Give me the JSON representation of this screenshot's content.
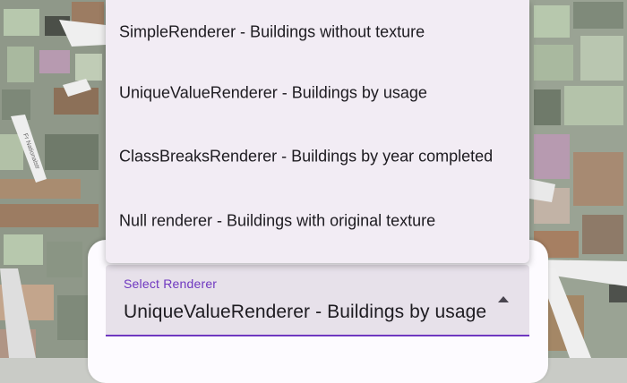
{
  "menu": {
    "items": [
      {
        "label": "SimpleRenderer - Buildings without texture"
      },
      {
        "label": "UniqueValueRenderer - Buildings by usage"
      },
      {
        "label": "ClassBreaksRenderer - Buildings by year completed"
      },
      {
        "label": "Null renderer - Buildings with original texture"
      }
    ]
  },
  "select": {
    "label": "Select Renderer",
    "value": "UniqueValueRenderer - Buildings by usage"
  },
  "map": {
    "street_label": "Fr Nationalstr",
    "colors": {
      "ground": "#c9cbc6",
      "roof_light": "#b7c8ad",
      "roof_dark": "#6f7a6a",
      "roof_brown": "#9c7c62",
      "roof_pink": "#b79ab0",
      "street": "#eeeeee"
    }
  },
  "theme": {
    "accent": "#6f38c0",
    "menu_bg": "#f2ecf4",
    "field_bg": "#e7e1ea"
  }
}
